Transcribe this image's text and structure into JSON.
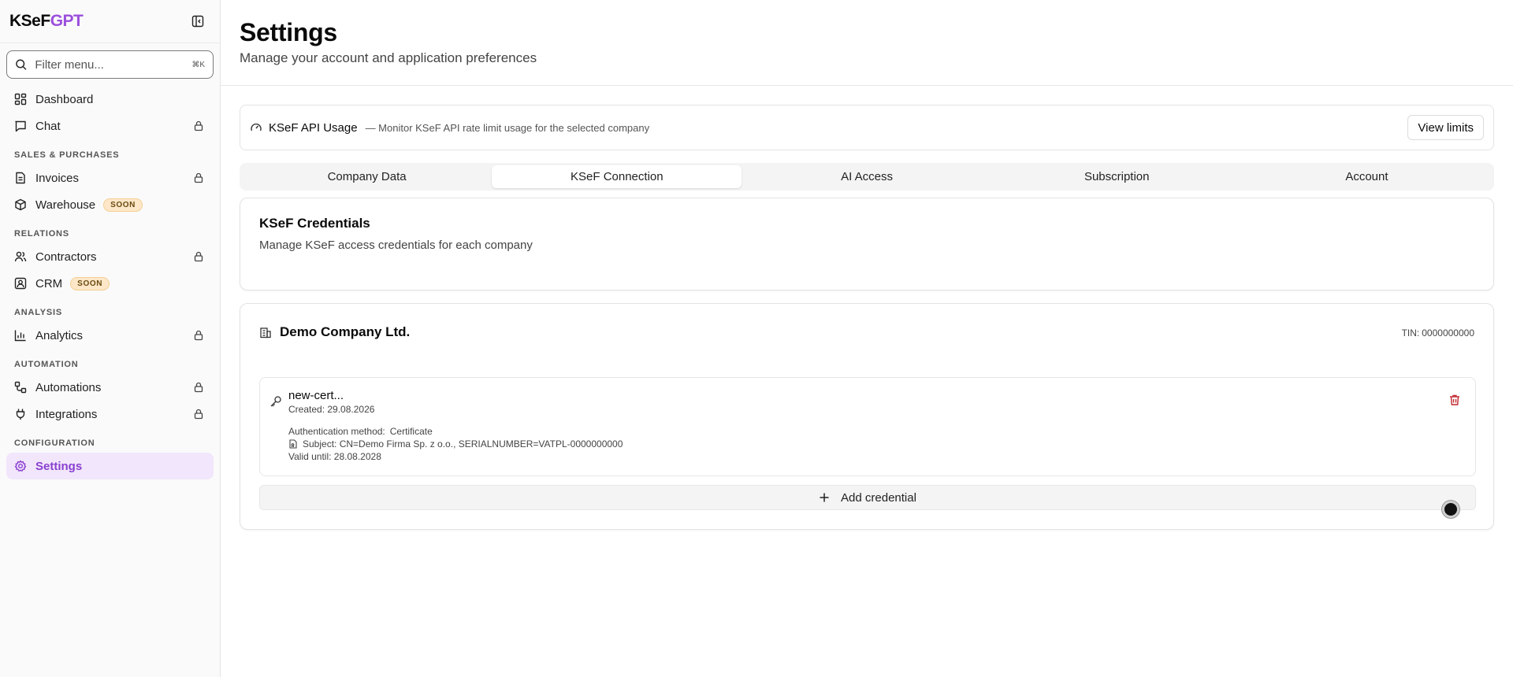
{
  "brand": {
    "logo_main": "KSeF",
    "logo_accent": "GPT",
    "accent_color": "#9b4fdc"
  },
  "sidebar": {
    "filter": {
      "placeholder": "Filter menu...",
      "shortcut": "⌘K"
    },
    "top_items": [
      {
        "label": "Dashboard",
        "icon": "dashboard-icon",
        "locked": false
      },
      {
        "label": "Chat",
        "icon": "chat-icon",
        "locked": true
      }
    ],
    "sections": [
      {
        "title": "SALES & PURCHASES",
        "items": [
          {
            "label": "Invoices",
            "icon": "invoice-icon",
            "locked": true
          },
          {
            "label": "Warehouse",
            "icon": "box-icon",
            "badge": "SOON"
          }
        ]
      },
      {
        "title": "RELATIONS",
        "items": [
          {
            "label": "Contractors",
            "icon": "users-icon",
            "locked": true
          },
          {
            "label": "CRM",
            "icon": "contact-icon",
            "badge": "SOON"
          }
        ]
      },
      {
        "title": "ANALYSIS",
        "items": [
          {
            "label": "Analytics",
            "icon": "bar-chart-icon",
            "locked": true
          }
        ]
      },
      {
        "title": "AUTOMATION",
        "items": [
          {
            "label": "Automations",
            "icon": "workflow-icon",
            "locked": true
          },
          {
            "label": "Integrations",
            "icon": "plug-icon",
            "locked": true
          }
        ]
      },
      {
        "title": "CONFIGURATION",
        "items": [
          {
            "label": "Settings",
            "icon": "gear-icon",
            "active": true
          }
        ]
      }
    ]
  },
  "header": {
    "title": "Settings",
    "subtitle": "Manage your account and application preferences"
  },
  "usage": {
    "title": "KSeF API Usage",
    "description": "— Monitor KSeF API rate limit usage for the selected company",
    "button": "View limits"
  },
  "tabs": [
    {
      "label": "Company Data",
      "active": false
    },
    {
      "label": "KSeF Connection",
      "active": true
    },
    {
      "label": "AI Access",
      "active": false
    },
    {
      "label": "Subscription",
      "active": false
    },
    {
      "label": "Account",
      "active": false
    }
  ],
  "credentials": {
    "title": "KSeF Credentials",
    "description": "Manage KSeF access credentials for each company"
  },
  "company": {
    "name": "Demo Company Ltd.",
    "tin_label": "TIN:",
    "tin_value": "0000000000",
    "credential": {
      "name": "new-cert...",
      "created": "Created: 29.08.2026",
      "auth_label": "Authentication method:",
      "auth_value": "Certificate",
      "subject": "Subject: CN=Demo Firma Sp. z o.o., SERIALNUMBER=VATPL-0000000000",
      "valid_until": "Valid until: 28.08.2028"
    },
    "add_button": "Add credential"
  },
  "colors": {
    "active_nav_bg": "#f1e6fb",
    "active_nav_text": "#8a3fd1",
    "badge_bg": "#fde7c8",
    "trash": "#c0262d"
  }
}
